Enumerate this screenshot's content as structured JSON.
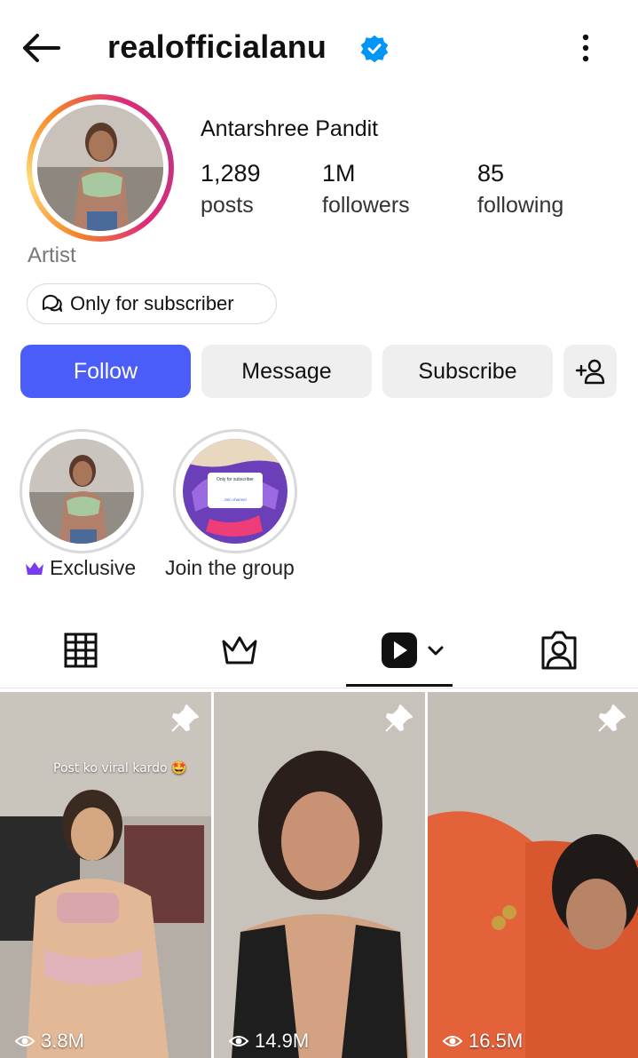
{
  "header": {
    "username": "realofficialanu",
    "verified": true
  },
  "profile": {
    "display_name": "Antarshree Pandit",
    "category": "Artist",
    "stats": [
      {
        "value": "1,289",
        "label": "posts"
      },
      {
        "value": "1M",
        "label": "followers"
      },
      {
        "value": "85",
        "label": "following"
      }
    ],
    "channel_chip": "Only for subscriber"
  },
  "actions": {
    "follow": "Follow",
    "message": "Message",
    "subscribe": "Subscribe"
  },
  "highlights": [
    {
      "label": "Exclusive",
      "icon": "crown-icon"
    },
    {
      "label": "Join the group",
      "icon": ""
    }
  ],
  "highlight_thumb_text": {
    "title": "Only for subscriber",
    "button": "Join channel"
  },
  "tabs": [
    "grid-icon",
    "crown-icon",
    "reels-icon",
    "tagged-icon"
  ],
  "reels": [
    {
      "views": "3.8M",
      "overlay_text": "Post ko viral kardo 🤩",
      "pinned": true
    },
    {
      "views": "14.9M",
      "overlay_text": "",
      "pinned": true
    },
    {
      "views": "16.5M",
      "overlay_text": "",
      "pinned": true
    }
  ],
  "colors": {
    "primary": "#4a5df9",
    "verified": "#0095f6",
    "crown": "#7a3cf0"
  }
}
